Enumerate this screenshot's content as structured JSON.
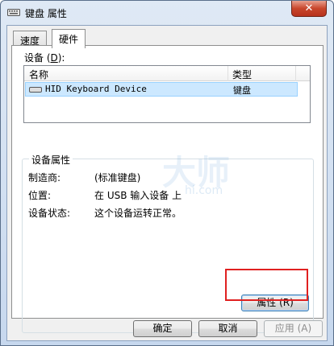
{
  "window": {
    "title": "键盘 属性",
    "close_symbol": "✕"
  },
  "tabs": [
    {
      "label": "速度",
      "active": false
    },
    {
      "label": "硬件",
      "active": true
    }
  ],
  "devices": {
    "label_prefix": "设备 (",
    "label_key": "D",
    "label_suffix": "):",
    "columns": [
      "名称",
      "类型"
    ],
    "rows": [
      {
        "name": "HID Keyboard Device",
        "type": "键盘",
        "selected": true
      }
    ]
  },
  "properties": {
    "group_title": "设备属性",
    "manufacturer_label": "制造商:",
    "manufacturer_value": "(标准键盘)",
    "location_label": "位置:",
    "location_value": "在 USB 输入设备 上",
    "status_label": "设备状态:",
    "status_value": "这个设备运转正常。",
    "properties_button_text": "属性",
    "properties_button_key": "(R)"
  },
  "watermark": {
    "main": "大师",
    "sub": "hi.com"
  },
  "footer": {
    "ok": "确定",
    "cancel": "取消",
    "apply_text": "应用",
    "apply_key": "(A)"
  },
  "colors": {
    "selection": "#cce8ff",
    "highlight_box": "#e02020",
    "close_button": "#c8462c"
  }
}
